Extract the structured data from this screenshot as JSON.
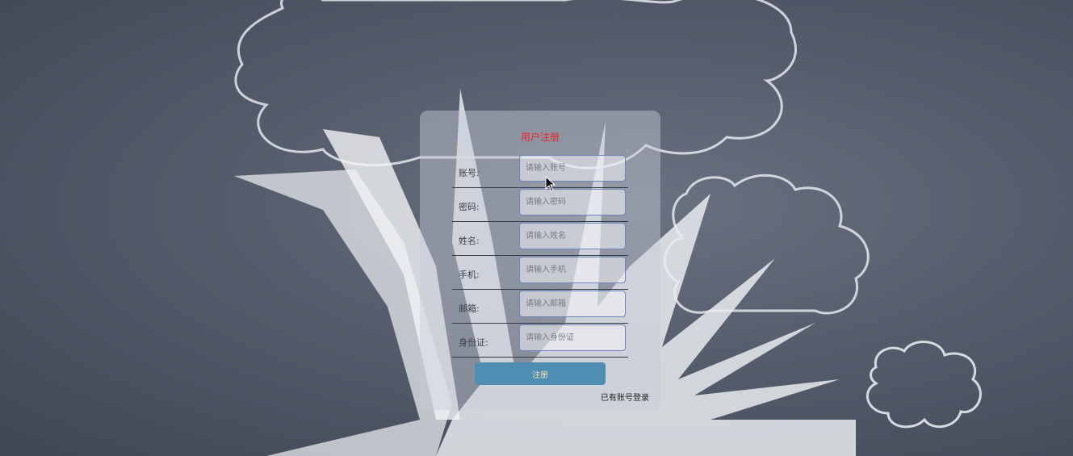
{
  "form": {
    "title": "用户注册",
    "fields": [
      {
        "label": "账号:",
        "placeholder": "请输入账号"
      },
      {
        "label": "密码:",
        "placeholder": "请输入密码"
      },
      {
        "label": "姓名:",
        "placeholder": "请输入姓名"
      },
      {
        "label": "手机:",
        "placeholder": "请输入手机"
      },
      {
        "label": "邮箱:",
        "placeholder": "请输入邮箱"
      },
      {
        "label": "身份证:",
        "placeholder": "请输入身份证"
      }
    ],
    "submit_label": "注册",
    "login_link": "已有账号登录"
  },
  "colors": {
    "title": "#e8252a",
    "button": "#4f8db2",
    "button_text": "#f2e6b0"
  }
}
